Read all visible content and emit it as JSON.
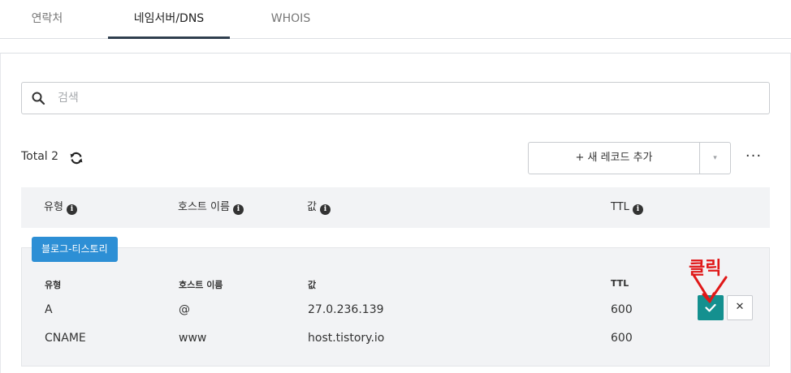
{
  "tabs": [
    {
      "label": "연락처"
    },
    {
      "label": "네임서버/DNS"
    },
    {
      "label": "WHOIS"
    }
  ],
  "search": {
    "placeholder": "검색"
  },
  "records": {
    "total_label": "Total 2"
  },
  "toolbar": {
    "add_record_label": "+ 새 레코드 추가",
    "caret": "▾",
    "more": "···"
  },
  "table_header": {
    "type": "유형",
    "host": "호스트 이름",
    "value": "값",
    "ttl": "TTL",
    "info_glyph": "i"
  },
  "group": {
    "name": "블로그-티스토리",
    "columns": {
      "type": "유형",
      "host": "호스트 이름",
      "value": "값",
      "ttl": "TTL"
    },
    "rows": [
      {
        "type": "A",
        "host": "@",
        "value": "27.0.236.139",
        "ttl": "600"
      },
      {
        "type": "CNAME",
        "host": "www",
        "value": "host.tistory.io",
        "ttl": "600"
      }
    ],
    "cancel_glyph": "✕"
  },
  "annotation": {
    "text": "클릭",
    "color": "#e01818"
  },
  "colors": {
    "accent": "#14908f",
    "badge": "#2d8fd5",
    "active_tab": "#2f3e4e"
  }
}
